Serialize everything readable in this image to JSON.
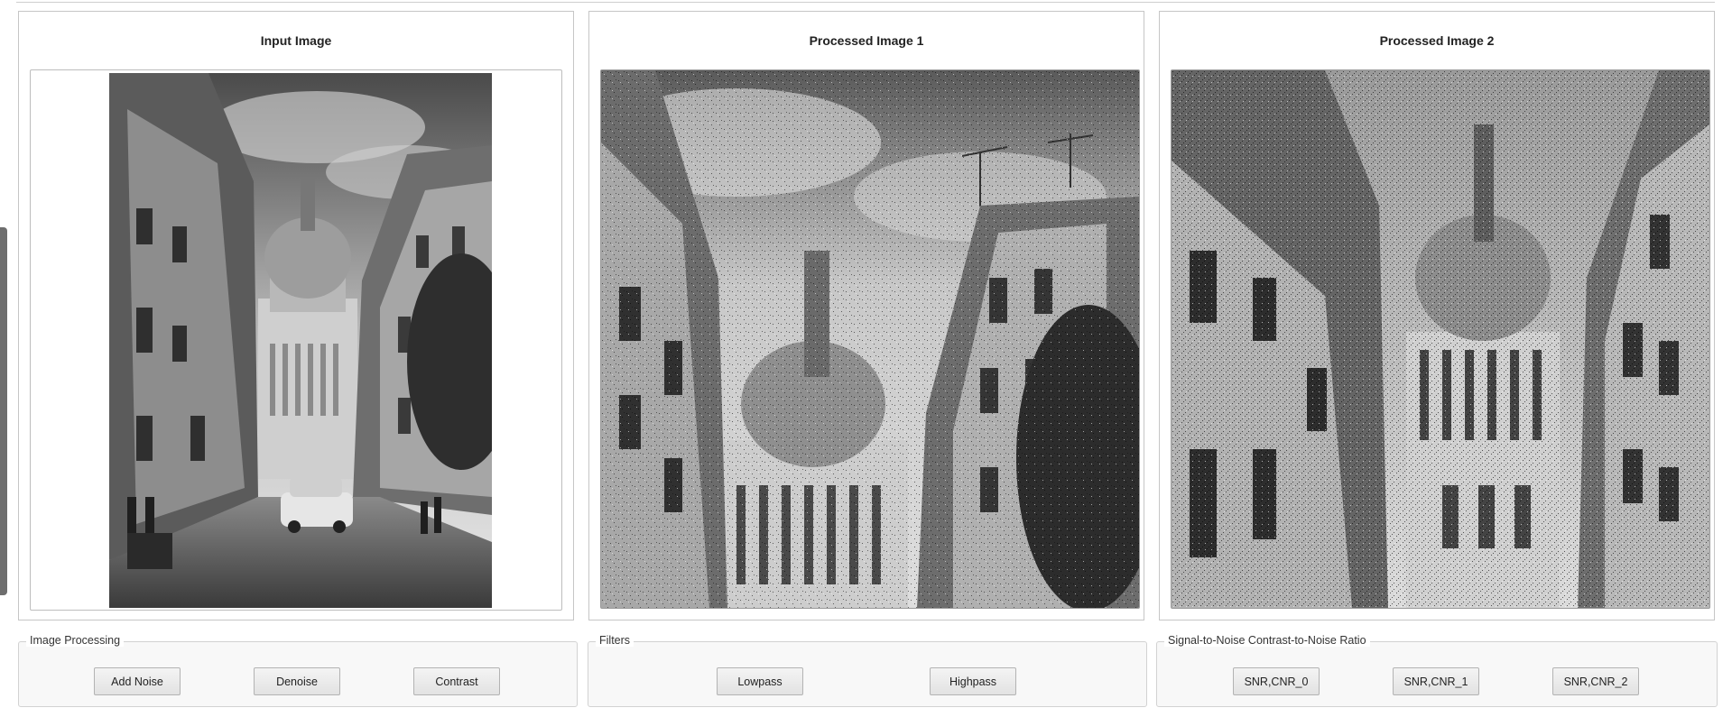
{
  "panels": {
    "input": {
      "title": "Input Image",
      "image_icon": "street-photo-icon"
    },
    "processed1": {
      "title": "Processed Image 1",
      "image_icon": "noisy-photo-icon"
    },
    "processed2": {
      "title": "Processed Image 2",
      "image_icon": "noisy-photo-icon"
    }
  },
  "groups": {
    "image_processing": {
      "legend": "Image Processing",
      "buttons": [
        "Add Noise",
        "Denoise",
        "Contrast"
      ]
    },
    "filters": {
      "legend": "Filters",
      "buttons": [
        "Lowpass",
        "Highpass"
      ]
    },
    "metrics": {
      "legend": "Signal-to-Noise  Contrast-to-Noise Ratio",
      "buttons": [
        "SNR,CNR_0",
        "SNR,CNR_1",
        "SNR,CNR_2"
      ]
    }
  },
  "colors": {
    "panel_border": "#c6c6c6",
    "button_bg": "#e9e9e9",
    "group_bg": "#f8f8f8"
  }
}
